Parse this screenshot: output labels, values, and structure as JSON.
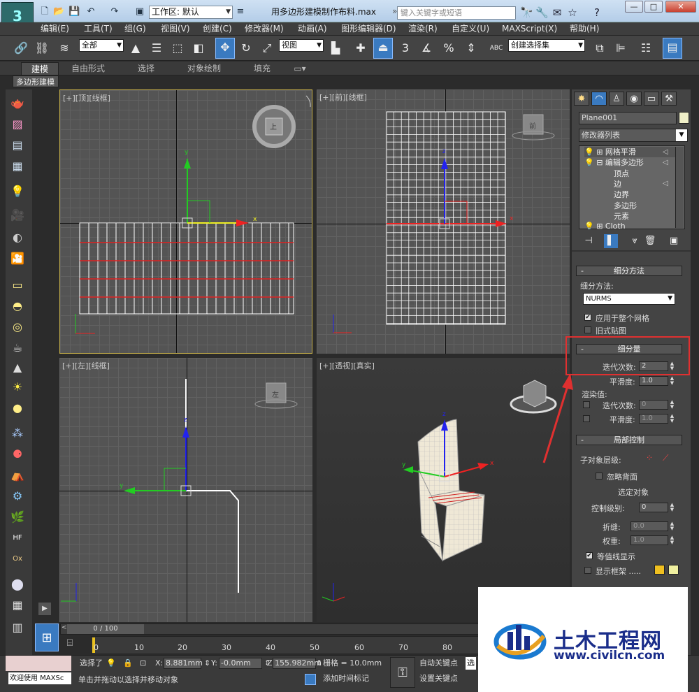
{
  "window": {
    "title": "用多边形建模制作布料.max",
    "workspace_label": "工作区: 默认",
    "search_placeholder": "键入关键字或短语"
  },
  "menu": [
    "编辑(E)",
    "工具(T)",
    "组(G)",
    "视图(V)",
    "创建(C)",
    "修改器(M)",
    "动画(A)",
    "图形编辑器(D)",
    "渲染(R)",
    "自定义(U)",
    "MAXScript(X)",
    "帮助(H)"
  ],
  "toolbar": {
    "selection_filter": "全部",
    "reference_coord": "视图",
    "named_selection": "创建选择集",
    "snap_3": "3",
    "snap_pct": "%",
    "abc": "ABC"
  },
  "ribbon": {
    "tabs": [
      "建模",
      "自由形式",
      "选择",
      "对象绘制",
      "填充"
    ],
    "active_tab": "建模",
    "sub": "多边形建模"
  },
  "viewports": {
    "top": "[+][顶][线框]",
    "front": "[+][前][线框]",
    "left": "[+][左][线框]",
    "persp": "[+][透视][真实]",
    "cube_top": "上",
    "cube_front": "前",
    "cube_left": "左",
    "axis_x": "x",
    "axis_y": "y",
    "axis_z": "z"
  },
  "panel": {
    "object_name": "Plane001",
    "modifier_list": "修改器列表",
    "stack": [
      "网格平滑",
      "编辑多边形",
      "顶点",
      "边",
      "边界",
      "多边形",
      "元素",
      "Cloth"
    ],
    "subdiv_method_title": "细分方法",
    "subdiv_method_label": "细分方法:",
    "subdiv_method_value": "NURMS",
    "apply_whole_mesh": "应用于整个网格",
    "old_style_map": "旧式贴图",
    "subdiv_amount_title": "细分量",
    "iterations_label": "迭代次数:",
    "iterations_value": "2",
    "smoothness_label": "平滑度:",
    "smoothness_value": "1.0",
    "render_values_label": "渲染值:",
    "render_iter_label": "迭代次数:",
    "render_iter_value": "0",
    "render_smooth_label": "平滑度:",
    "render_smooth_value": "1.0",
    "local_control_title": "局部控制",
    "sub_object_level": "子对象层级:",
    "ignore_backface": "忽略背面",
    "selected_objects": "选定对象",
    "control_level_label": "控制级别:",
    "control_level_value": "0",
    "crease_label": "折缝:",
    "crease_value": "0.0",
    "weight_label": "权重:",
    "weight_value": "1.0",
    "isoline_display": "等值线显示",
    "show_cage": "显示框架 ....."
  },
  "timeline": {
    "slider": "0 / 100",
    "ticks": [
      "0",
      "10",
      "20",
      "30",
      "40",
      "50",
      "60",
      "70",
      "80"
    ]
  },
  "status": {
    "welcome": "欢迎使用 MAXSc",
    "select_label": "选择了",
    "x_label": "X:",
    "x_value": "8.881mm",
    "y_label": "Y:",
    "y_value": "-0.0mm",
    "z_label": "Z:",
    "z_value": "155.982mm",
    "grid": "栅格 = 10.0mm",
    "auto_key": "自动关键点",
    "set_key": "设置关键点",
    "sel_short": "选",
    "add_time_tag": "添加时间标记",
    "message": "单击并拖动以选择并移动对象"
  },
  "watermark": {
    "name": "土木工程网",
    "url": "www.civilcn.com"
  }
}
